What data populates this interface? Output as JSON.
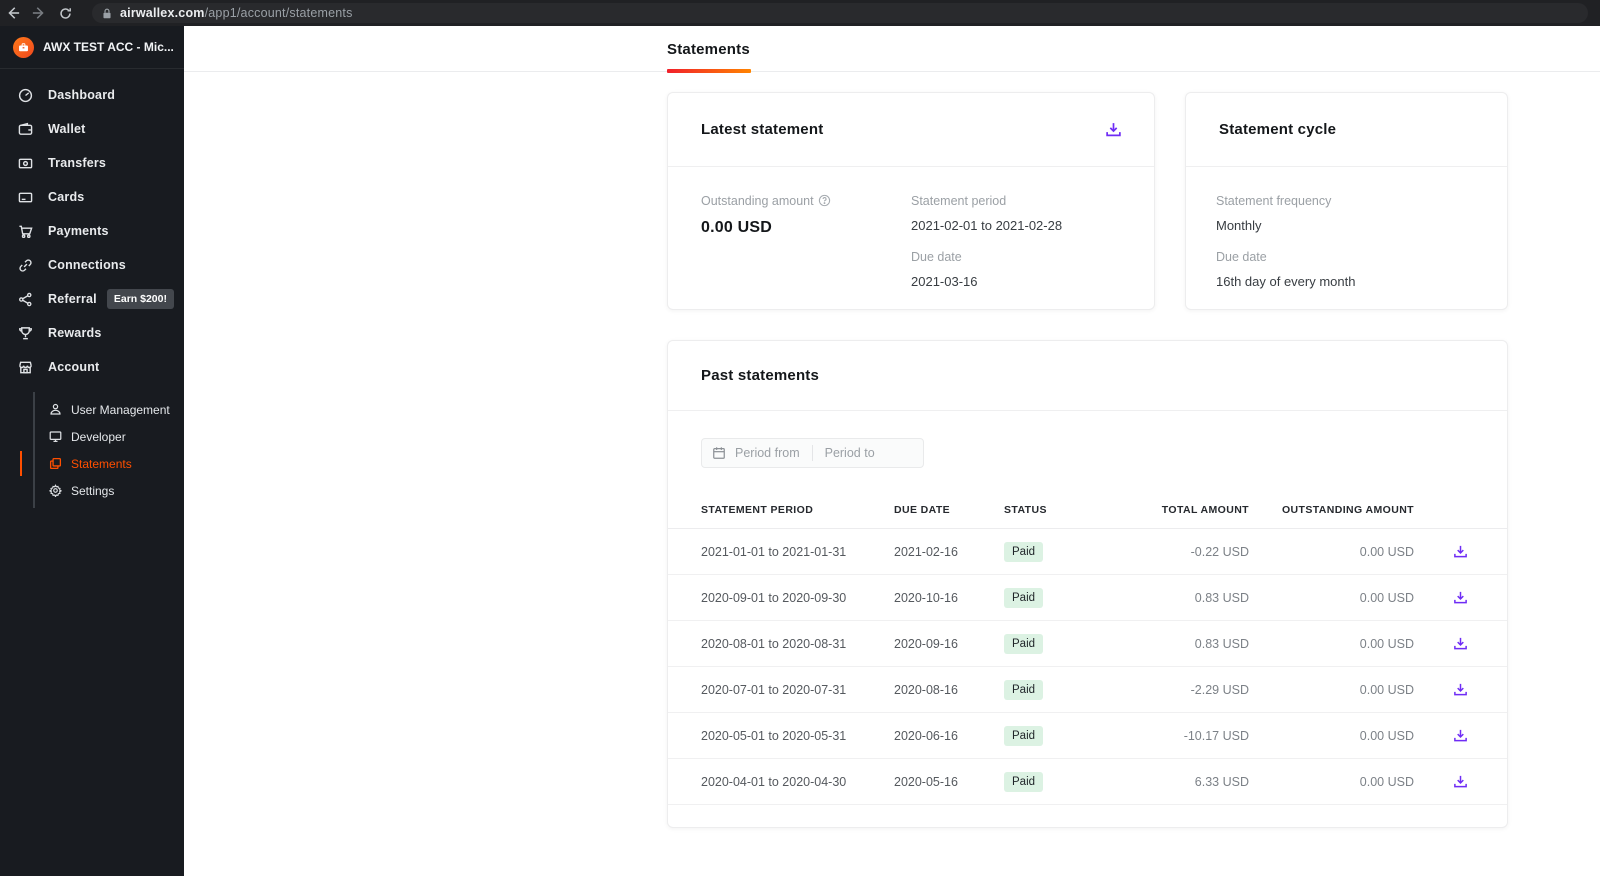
{
  "browser": {
    "url_domain": "airwallex.com",
    "url_path": "/app1/account/statements"
  },
  "colors": {
    "brand_orange": "#ff4f00",
    "tab_gradient_left": "#f1202b",
    "tab_gradient_right": "#ff8400",
    "download_purple": "#6f2cf5",
    "paid_badge_bg": "#dcf2e3",
    "sidebar_bg": "#181b20"
  },
  "sidebar": {
    "account_name": "AWX TEST ACC - Mic...",
    "items": [
      {
        "label": "Dashboard"
      },
      {
        "label": "Wallet"
      },
      {
        "label": "Transfers"
      },
      {
        "label": "Cards"
      },
      {
        "label": "Payments"
      },
      {
        "label": "Connections"
      },
      {
        "label": "Referral",
        "badge": "Earn $200!"
      },
      {
        "label": "Rewards"
      },
      {
        "label": "Account"
      }
    ],
    "account_subitems": [
      {
        "label": "User Management"
      },
      {
        "label": "Developer"
      },
      {
        "label": "Statements"
      },
      {
        "label": "Settings"
      }
    ]
  },
  "header": {
    "title": "Statements"
  },
  "latest_statement": {
    "title": "Latest statement",
    "outstanding_label": "Outstanding amount",
    "outstanding_value": "0.00 USD",
    "period_label": "Statement period",
    "period_value": "2021-02-01 to 2021-02-28",
    "due_label": "Due date",
    "due_value": "2021-03-16"
  },
  "statement_cycle": {
    "title": "Statement cycle",
    "frequency_label": "Statement frequency",
    "frequency_value": "Monthly",
    "due_label": "Due date",
    "due_value": "16th day of every month"
  },
  "past_statements": {
    "title": "Past statements",
    "filter": {
      "period_from_placeholder": "Period from",
      "period_to_placeholder": "Period to"
    },
    "columns": [
      "STATEMENT PERIOD",
      "DUE DATE",
      "STATUS",
      "TOTAL AMOUNT",
      "OUTSTANDING AMOUNT"
    ],
    "rows": [
      {
        "period": "2021-01-01 to 2021-01-31",
        "due_date": "2021-02-16",
        "status": "Paid",
        "total": "-0.22 USD",
        "outstanding": "0.00 USD"
      },
      {
        "period": "2020-09-01 to 2020-09-30",
        "due_date": "2020-10-16",
        "status": "Paid",
        "total": "0.83 USD",
        "outstanding": "0.00 USD"
      },
      {
        "period": "2020-08-01 to 2020-08-31",
        "due_date": "2020-09-16",
        "status": "Paid",
        "total": "0.83 USD",
        "outstanding": "0.00 USD"
      },
      {
        "period": "2020-07-01 to 2020-07-31",
        "due_date": "2020-08-16",
        "status": "Paid",
        "total": "-2.29 USD",
        "outstanding": "0.00 USD"
      },
      {
        "period": "2020-05-01 to 2020-05-31",
        "due_date": "2020-06-16",
        "status": "Paid",
        "total": "-10.17 USD",
        "outstanding": "0.00 USD"
      },
      {
        "period": "2020-04-01 to 2020-04-30",
        "due_date": "2020-05-16",
        "status": "Paid",
        "total": "6.33 USD",
        "outstanding": "0.00 USD"
      }
    ]
  }
}
